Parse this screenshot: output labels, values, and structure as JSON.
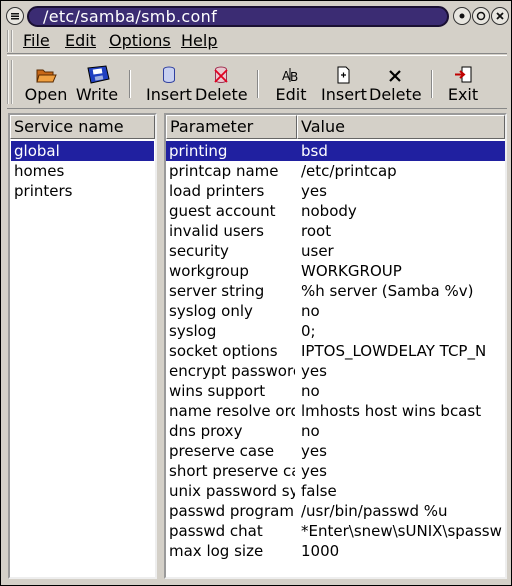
{
  "window": {
    "title": "/etc/samba/smb.conf"
  },
  "menu": [
    "File",
    "Edit",
    "Options",
    "Help"
  ],
  "toolbar": {
    "open": "Open",
    "write": "Write",
    "insert_service": "Insert",
    "delete_service": "Delete",
    "edit": "Edit",
    "insert_param": "Insert",
    "delete_param": "Delete",
    "exit": "Exit"
  },
  "services": {
    "header": "Service name",
    "items": [
      "global",
      "homes",
      "printers"
    ],
    "selected_index": 0
  },
  "parameters": {
    "header_param": "Parameter",
    "header_value": "Value",
    "selected_index": 0,
    "rows": [
      {
        "param": "printing",
        "value": "bsd"
      },
      {
        "param": "printcap name",
        "value": "/etc/printcap"
      },
      {
        "param": "load printers",
        "value": "yes"
      },
      {
        "param": "guest account",
        "value": "nobody"
      },
      {
        "param": "invalid users",
        "value": "root"
      },
      {
        "param": "security",
        "value": "user"
      },
      {
        "param": "workgroup",
        "value": "WORKGROUP"
      },
      {
        "param": "server string",
        "value": "%h server (Samba %v)"
      },
      {
        "param": "syslog only",
        "value": "no"
      },
      {
        "param": "syslog",
        "value": "0;"
      },
      {
        "param": "socket options",
        "value": "IPTOS_LOWDELAY TCP_N"
      },
      {
        "param": "encrypt passworc",
        "value": "yes"
      },
      {
        "param": "wins support",
        "value": "no"
      },
      {
        "param": "name resolve ord",
        "value": "lmhosts host wins bcast"
      },
      {
        "param": "dns proxy",
        "value": "no"
      },
      {
        "param": "preserve case",
        "value": "yes"
      },
      {
        "param": "short preserve ca",
        "value": "yes"
      },
      {
        "param": "unix password sy",
        "value": "false"
      },
      {
        "param": "passwd program",
        "value": "/usr/bin/passwd %u"
      },
      {
        "param": "passwd chat",
        "value": "*Enter\\snew\\sUNIX\\spassw"
      },
      {
        "param": "max log size",
        "value": "1000"
      }
    ]
  },
  "colors": {
    "selection": "#2020a0",
    "title_bar": "#3b2c73"
  }
}
